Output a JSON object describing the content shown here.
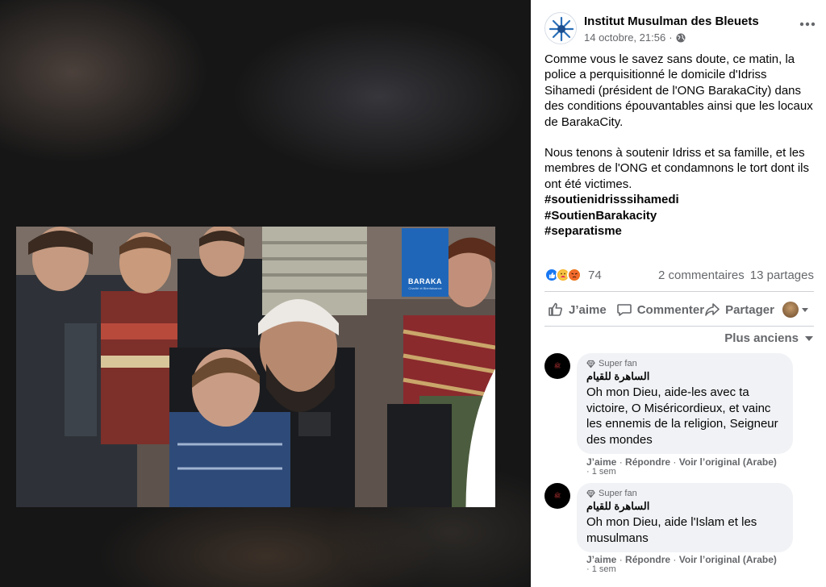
{
  "photo": {
    "banner_text": "BARAKA",
    "banner_subtext": "Charité et Bienfaisance",
    "banner_color": "#1f66b8"
  },
  "post": {
    "page_name": "Institut Musulman des Bleuets",
    "date": "14 octobre, 21:56",
    "separator": "·",
    "paragraph1": "Comme vous le savez sans doute, ce matin, la police a perquisitionné le domicile d'Idriss Sihamedi (président de l'ONG BarakaCity) dans des conditions épouvantables ainsi que les locaux de BarakaCity.",
    "paragraph2": "Nous tenons à soutenir Idriss et sa famille, et les membres de l'ONG et condamnons le tort dont ils ont été victimes.",
    "hashtags": [
      "#soutienidrisssihamedi",
      "#SoutienBarakacity",
      "#separatisme"
    ]
  },
  "reactions": {
    "count": "74",
    "comments": "2 commentaires",
    "shares": "13 partages"
  },
  "actions": {
    "like": "J’aime",
    "comment": "Commenter",
    "share": "Partager"
  },
  "sort": {
    "label": "Plus anciens"
  },
  "comments": [
    {
      "badge": "Super fan",
      "author": "الساهرة للقيام",
      "text": "Oh mon Dieu, aide-les avec ta victoire, O Miséricordieux, et vainc les ennemis de la religion, Seigneur des mondes",
      "like": "J’aime",
      "reply": "Répondre",
      "translate": "Voir l’original (Arabe)",
      "dot": "·",
      "time": "· 1 sem"
    },
    {
      "badge": "Super fan",
      "author": "الساهرة للقيام",
      "text": "Oh mon Dieu, aide l'Islam et les musulmans",
      "like": "J’aime",
      "reply": "Répondre",
      "translate": "Voir l’original (Arabe)",
      "dot": "·",
      "time": "· 1 sem"
    }
  ],
  "colors": {
    "text_primary": "#050505",
    "text_secondary": "#65676b",
    "bubble": "#f0f2f5",
    "like_blue": "#1877f2"
  }
}
